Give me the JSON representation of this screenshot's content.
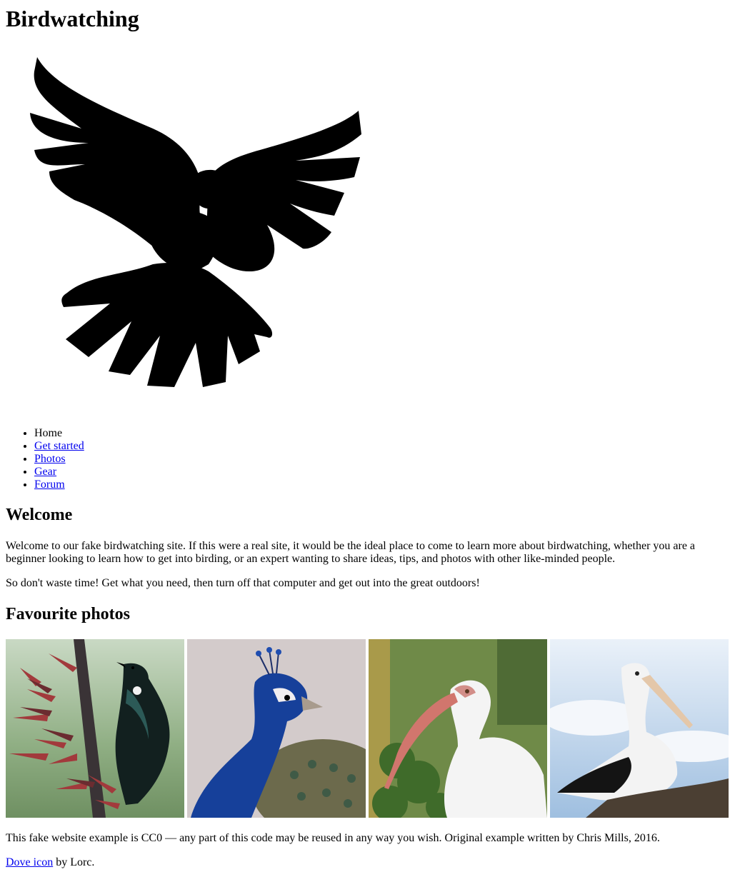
{
  "header": {
    "title": "Birdwatching",
    "logo_icon": "dove-icon"
  },
  "nav": {
    "items": [
      {
        "label": "Home",
        "link": false
      },
      {
        "label": "Get started",
        "link": true
      },
      {
        "label": "Photos",
        "link": true
      },
      {
        "label": "Gear",
        "link": true
      },
      {
        "label": "Forum",
        "link": true
      }
    ],
    "link_color": "#0000ee"
  },
  "welcome": {
    "heading": "Welcome",
    "intro": "Welcome to our fake birdwatching site. If this were a real site, it would be the ideal place to come to learn more about birdwatching, whether you are a beginner looking to learn how to get into birding, or an expert wanting to share ideas, tips, and photos with other like-minded people.",
    "cta": "So don't waste time! Get what you need, then turn off that computer and get out into the great outdoors!"
  },
  "favourites": {
    "heading": "Favourite photos",
    "photos": [
      "tui-photo",
      "peacock-photo",
      "ibis-photo",
      "pelican-photo"
    ]
  },
  "footer": {
    "license": "This fake website example is CC0 — any part of this code may be reused in any way you wish. Original example written by Chris Mills, 2016.",
    "credit_link": "Dove icon",
    "credit_rest": " by Lorc."
  }
}
